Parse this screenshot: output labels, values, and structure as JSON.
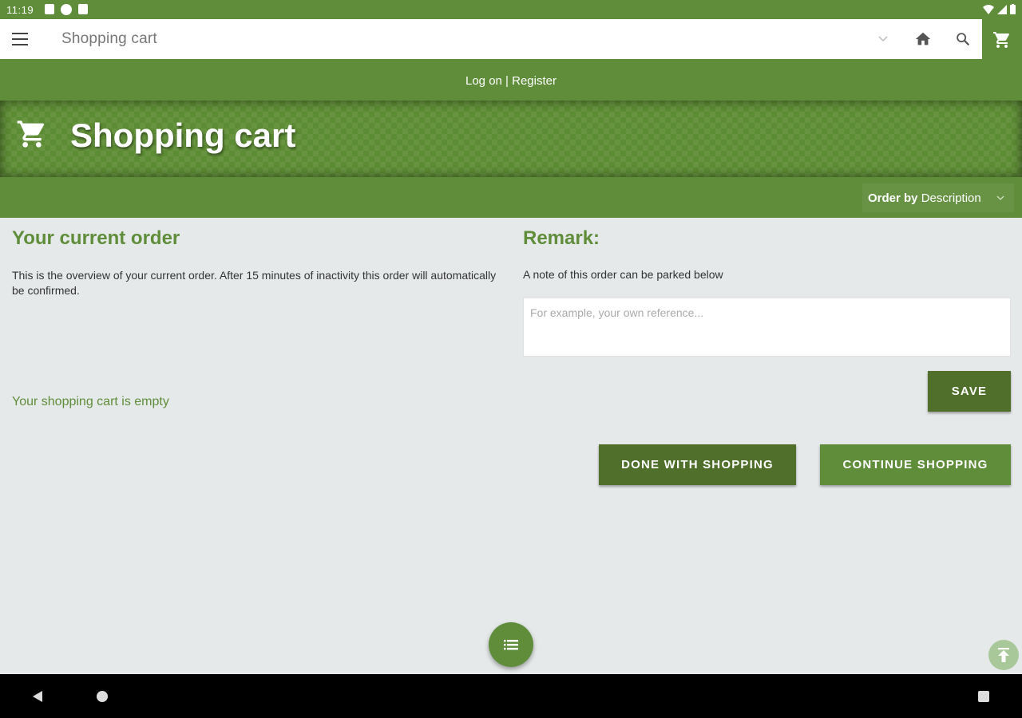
{
  "status_bar": {
    "time": "11:19"
  },
  "app_bar": {
    "title": "Shopping cart"
  },
  "auth": {
    "login_label": "Log on",
    "separator": " | ",
    "register_label": "Register"
  },
  "banner": {
    "title": "Shopping cart"
  },
  "order_by": {
    "prefix": "Order by",
    "value": "Description"
  },
  "current_order": {
    "heading": "Your current order",
    "description": "This is the overview of your current order. After 15 minutes of inactivity this order will automatically be confirmed.",
    "empty_message": "Your shopping cart is empty"
  },
  "remark": {
    "heading": "Remark:",
    "description": "A note of this order can be parked below",
    "placeholder": "For example, your own reference...",
    "value": "",
    "save_label": "SAVE"
  },
  "actions": {
    "done_label": "DONE WITH SHOPPING",
    "continue_label": "CONTINUE SHOPPING"
  },
  "colors": {
    "primary": "#5f8d3a",
    "primary_dark": "#4f6f2a",
    "background": "#e6e9ea"
  },
  "icons": [
    "menu-icon",
    "chevron-down-icon",
    "home-icon",
    "search-icon",
    "cart-icon",
    "list-icon",
    "arrow-up-icon"
  ]
}
